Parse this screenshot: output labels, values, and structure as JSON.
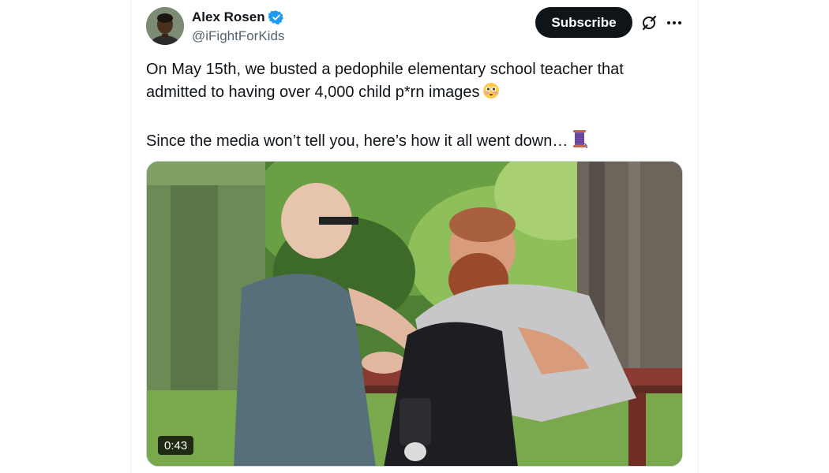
{
  "author": {
    "name": "Alex Rosen",
    "handle": "@iFightForKids",
    "verified": true,
    "verified_color": "#1d9bf0"
  },
  "actions": {
    "subscribe_label": "Subscribe",
    "grok_icon": "grok-icon",
    "more_icon": "more-icon"
  },
  "tweet": {
    "line1": "On May 15th, we busted a pedophile elementary school teacher that admitted to having over 4,000 child p*rn images",
    "line1_emoji": "flushed-face-emoji",
    "line2": "Since the media won’t tell you, here’s how it all went down…",
    "line2_emoji": "thread-spool-emoji"
  },
  "media": {
    "type": "video",
    "duration": "0:43"
  },
  "colors": {
    "text": "#0f1419",
    "secondary": "#536471",
    "button_bg": "#0f1419"
  }
}
